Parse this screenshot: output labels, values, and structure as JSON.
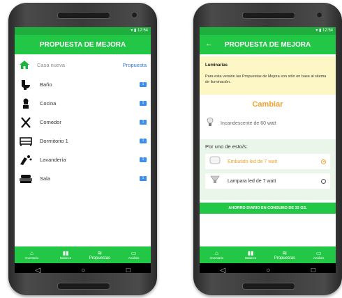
{
  "left_screen": {
    "status_time": "12:54",
    "title": "PROPUESTA DE MEJORA",
    "house": {
      "name": "Casa nueva",
      "action": "Propuesta"
    },
    "rooms": [
      {
        "name": "Baño",
        "icon": "toilet-icon",
        "badge": "1"
      },
      {
        "name": "Cocina",
        "icon": "chef-icon",
        "badge": "1"
      },
      {
        "name": "Comedor",
        "icon": "cutlery-icon",
        "badge": "1"
      },
      {
        "name": "Dormitorio 1",
        "icon": "bed-icon",
        "badge": "1"
      },
      {
        "name": "Lavandería",
        "icon": "laundry-icon",
        "badge": "1"
      },
      {
        "name": "Sala",
        "icon": "sofa-icon",
        "badge": "1"
      }
    ]
  },
  "right_screen": {
    "status_time": "12:54",
    "title": "PROPUESTA DE MEJORA",
    "notice_title": "Luminarias",
    "notice_body": "Para esta versión las Propuestas de Mejora son sólo en base al sitema de iluminación.",
    "change_label": "Cambiar",
    "current_item": "Incandescente de 60 watt",
    "replace_title": "Por uno de esto/s:",
    "options": [
      {
        "label": "Embutido led de 7 watt",
        "selected": true
      },
      {
        "label": "Lampara led de 7 watt",
        "selected": false
      }
    ],
    "savings_text": "AHORRO DIARIO EN CONSUMO DE 32 GS."
  },
  "bottom_nav": [
    "Inventario",
    "Balance",
    "Propuestas",
    "Análisis"
  ],
  "colors": {
    "primary": "#22c746",
    "accent": "#f0a42b",
    "badge": "#3d8ee8",
    "notice_bg": "#fdf7c5"
  }
}
